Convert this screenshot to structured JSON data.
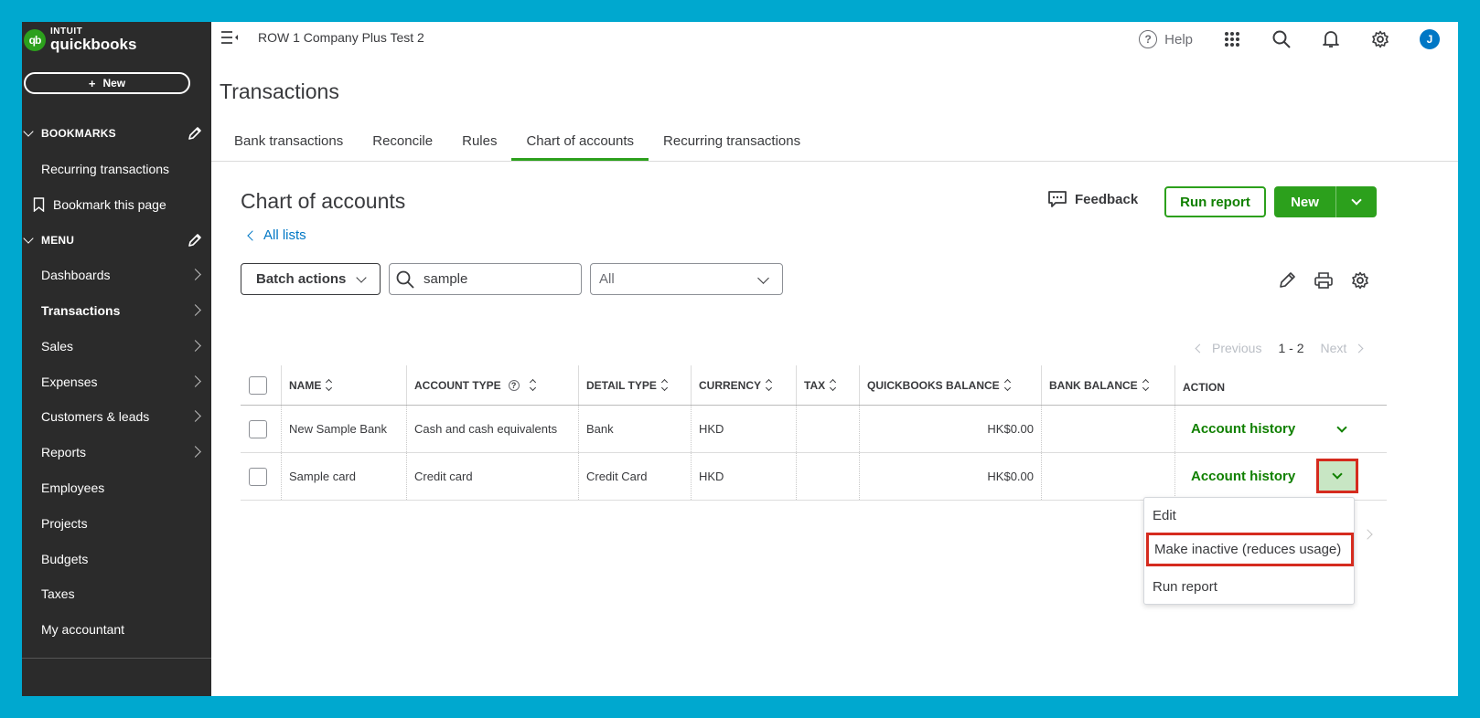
{
  "brand": {
    "line1": "INTUIT",
    "line2": "quickbooks",
    "mark": "qb"
  },
  "sidebar": {
    "new_label": "New",
    "bookmarks_header": "BOOKMARKS",
    "bookmarks": [
      {
        "label": "Recurring transactions"
      },
      {
        "label": "Bookmark this page",
        "icon": "bookmark-icon"
      }
    ],
    "menu_header": "MENU",
    "menu": [
      {
        "label": "Dashboards",
        "arrow": true
      },
      {
        "label": "Transactions",
        "arrow": true,
        "active": true
      },
      {
        "label": "Sales",
        "arrow": true
      },
      {
        "label": "Expenses",
        "arrow": true
      },
      {
        "label": "Customers & leads",
        "arrow": true
      },
      {
        "label": "Reports",
        "arrow": true
      },
      {
        "label": "Employees"
      },
      {
        "label": "Projects"
      },
      {
        "label": "Budgets"
      },
      {
        "label": "Taxes"
      },
      {
        "label": "My accountant"
      }
    ]
  },
  "topbar": {
    "company": "ROW 1 Company Plus Test 2",
    "help": "Help",
    "avatar": "J"
  },
  "page": {
    "title": "Transactions",
    "tabs": [
      {
        "label": "Bank transactions"
      },
      {
        "label": "Reconcile"
      },
      {
        "label": "Rules"
      },
      {
        "label": "Chart of accounts",
        "active": true
      },
      {
        "label": "Recurring transactions"
      }
    ]
  },
  "coa": {
    "title": "Chart of accounts",
    "all_lists": "All lists",
    "feedback": "Feedback",
    "run_report": "Run report",
    "new": "New",
    "batch_actions": "Batch actions",
    "search_value": "sample",
    "filter_value": "All"
  },
  "pager": {
    "previous": "Previous",
    "range": "1 - 2",
    "next": "Next"
  },
  "table": {
    "headers": [
      "NAME",
      "ACCOUNT TYPE",
      "DETAIL TYPE",
      "CURRENCY",
      "TAX",
      "QUICKBOOKS BALANCE",
      "BANK BALANCE",
      "ACTION"
    ],
    "rows": [
      {
        "name": "New Sample Bank",
        "account_type": "Cash and cash equivalents",
        "detail_type": "Bank",
        "currency": "HKD",
        "tax": "",
        "qb_balance": "HK$0.00",
        "bank_balance": "",
        "action": "Account history"
      },
      {
        "name": "Sample card",
        "account_type": "Credit card",
        "detail_type": "Credit Card",
        "currency": "HKD",
        "tax": "",
        "qb_balance": "HK$0.00",
        "bank_balance": "",
        "action": "Account history"
      }
    ]
  },
  "dropdown_menu": {
    "items": [
      {
        "label": "Edit"
      },
      {
        "label": "Make inactive (reduces usage)",
        "highlighted": true
      },
      {
        "label": "Run report"
      }
    ]
  },
  "colors": {
    "brand_green": "#2ca01c",
    "link_blue": "#0077c5",
    "highlight_red": "#d52b1e",
    "sidebar_bg": "#2b2b2b",
    "frame_bg": "#00a8cf"
  }
}
